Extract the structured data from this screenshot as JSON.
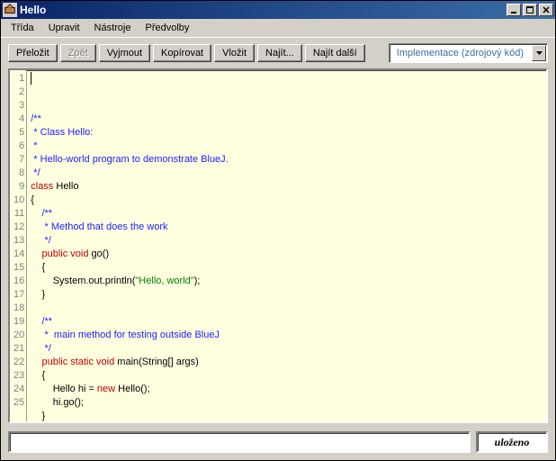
{
  "window": {
    "title": "Hello"
  },
  "menu": {
    "items": [
      "Třída",
      "Upravit",
      "Nástroje",
      "Předvolby"
    ]
  },
  "toolbar": {
    "compile": "Přeložit",
    "undo": "Zpět",
    "cut": "Vyjmout",
    "copy": "Kopírovat",
    "paste": "Vložit",
    "find": "Najít...",
    "find_next": "Najít další",
    "view_dropdown": "Implementace (zdrojový kód)"
  },
  "editor": {
    "line_count": 25,
    "lines": [
      {
        "segs": [
          {
            "t": "/**",
            "c": "c-comment"
          }
        ]
      },
      {
        "segs": [
          {
            "t": " * Class Hello:",
            "c": "c-comment"
          }
        ]
      },
      {
        "segs": [
          {
            "t": " *",
            "c": "c-comment"
          }
        ]
      },
      {
        "segs": [
          {
            "t": " * Hello-world program to demonstrate BlueJ.",
            "c": "c-comment"
          }
        ]
      },
      {
        "segs": [
          {
            "t": " */",
            "c": "c-comment"
          }
        ]
      },
      {
        "segs": [
          {
            "t": "class",
            "c": "c-key"
          },
          {
            "t": " Hello",
            "c": "c-plain"
          }
        ]
      },
      {
        "segs": [
          {
            "t": "{",
            "c": "c-plain"
          }
        ]
      },
      {
        "segs": [
          {
            "t": "    /**",
            "c": "c-comment"
          }
        ]
      },
      {
        "segs": [
          {
            "t": "     * Method that does the work",
            "c": "c-comment"
          }
        ]
      },
      {
        "segs": [
          {
            "t": "     */",
            "c": "c-comment"
          }
        ]
      },
      {
        "segs": [
          {
            "t": "    ",
            "c": "c-plain"
          },
          {
            "t": "public",
            "c": "c-key"
          },
          {
            "t": " ",
            "c": "c-plain"
          },
          {
            "t": "void",
            "c": "c-key"
          },
          {
            "t": " go()",
            "c": "c-plain"
          }
        ]
      },
      {
        "segs": [
          {
            "t": "    {",
            "c": "c-plain"
          }
        ]
      },
      {
        "segs": [
          {
            "t": "        System.out.println(",
            "c": "c-plain"
          },
          {
            "t": "\"Hello, world\"",
            "c": "c-str"
          },
          {
            "t": ");",
            "c": "c-plain"
          }
        ]
      },
      {
        "segs": [
          {
            "t": "    }",
            "c": "c-plain"
          }
        ]
      },
      {
        "segs": []
      },
      {
        "segs": [
          {
            "t": "    /**",
            "c": "c-comment"
          }
        ]
      },
      {
        "segs": [
          {
            "t": "     *  main method for testing outside BlueJ",
            "c": "c-comment"
          }
        ]
      },
      {
        "segs": [
          {
            "t": "     */",
            "c": "c-comment"
          }
        ]
      },
      {
        "segs": [
          {
            "t": "    ",
            "c": "c-plain"
          },
          {
            "t": "public",
            "c": "c-key"
          },
          {
            "t": " ",
            "c": "c-plain"
          },
          {
            "t": "static",
            "c": "c-key"
          },
          {
            "t": " ",
            "c": "c-plain"
          },
          {
            "t": "void",
            "c": "c-key"
          },
          {
            "t": " main(String[] args)",
            "c": "c-plain"
          }
        ]
      },
      {
        "segs": [
          {
            "t": "    {",
            "c": "c-plain"
          }
        ]
      },
      {
        "segs": [
          {
            "t": "        Hello hi = ",
            "c": "c-plain"
          },
          {
            "t": "new",
            "c": "c-key"
          },
          {
            "t": " Hello();",
            "c": "c-plain"
          }
        ]
      },
      {
        "segs": [
          {
            "t": "        hi.go();",
            "c": "c-plain"
          }
        ]
      },
      {
        "segs": [
          {
            "t": "    }",
            "c": "c-plain"
          }
        ]
      },
      {
        "segs": [
          {
            "t": "}",
            "c": "c-plain"
          }
        ]
      },
      {
        "segs": []
      }
    ]
  },
  "status": {
    "text": "uloženo"
  }
}
